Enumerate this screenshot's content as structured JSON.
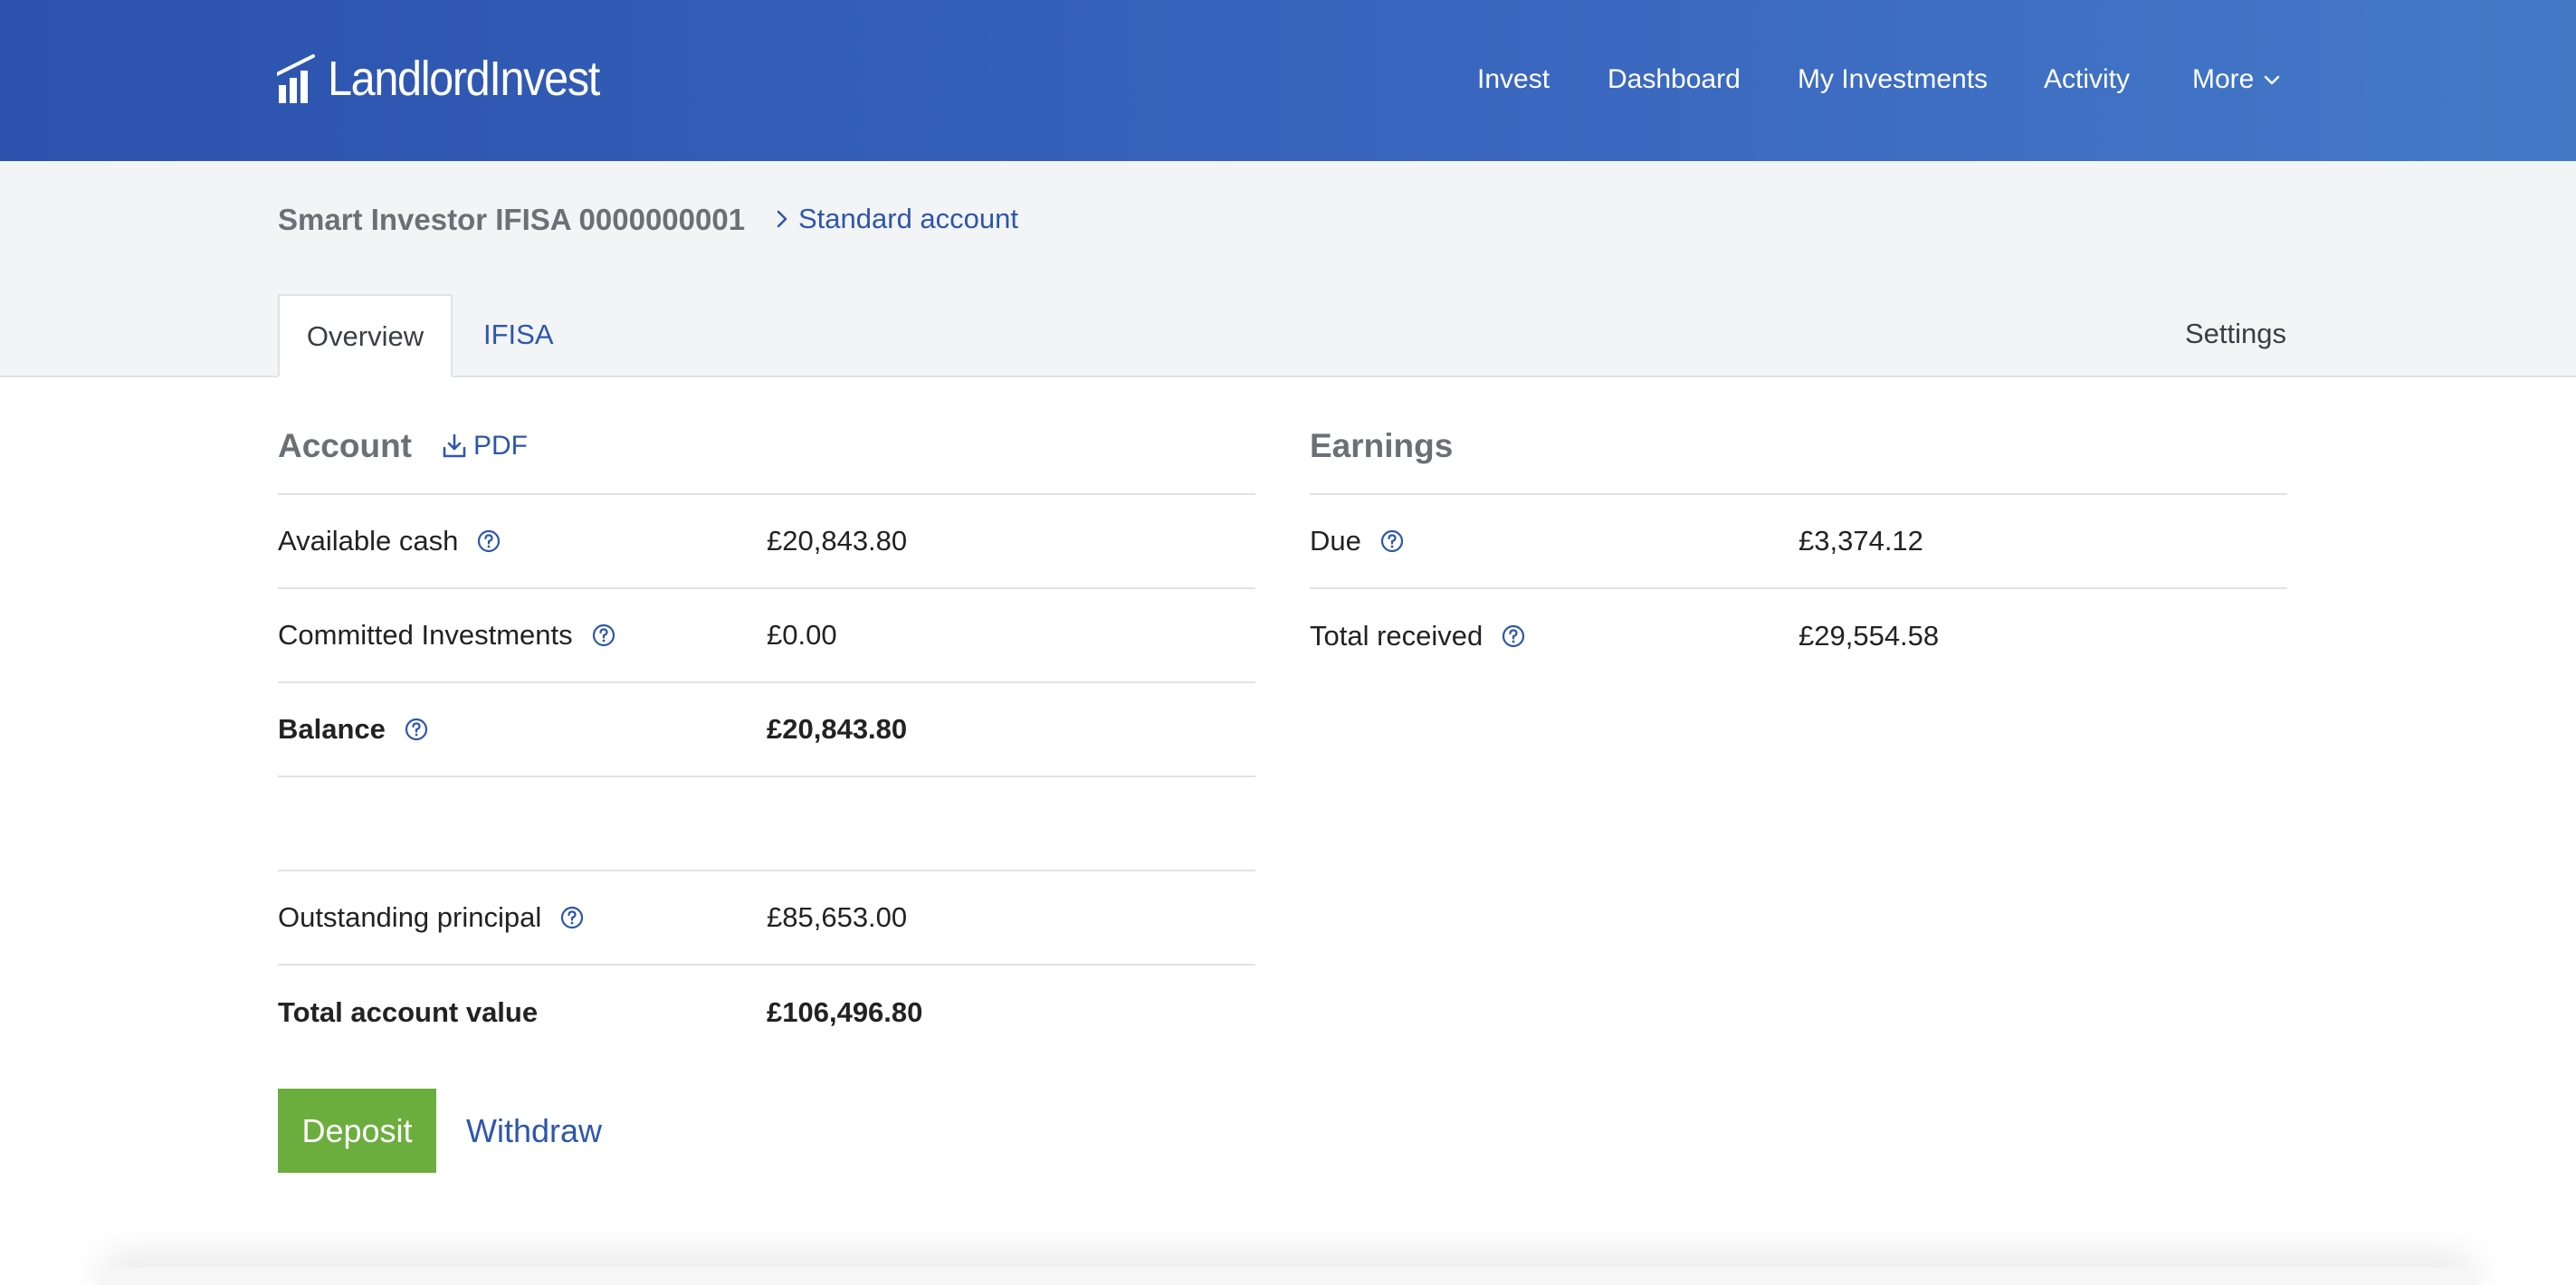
{
  "header": {
    "logo_text": "LandlordInvest",
    "nav": [
      {
        "label": "Invest"
      },
      {
        "label": "Dashboard"
      },
      {
        "label": "My Investments"
      },
      {
        "label": "Activity"
      },
      {
        "label": "More"
      }
    ]
  },
  "account_bar": {
    "title": "Smart Investor IFISA 0000000001",
    "switch_link": "Standard account"
  },
  "tabs": [
    {
      "label": "Overview",
      "active": true
    },
    {
      "label": "IFISA",
      "active": false
    }
  ],
  "settings_label": "Settings",
  "account": {
    "title": "Account",
    "pdf_label": "PDF",
    "rows": [
      {
        "label": "Available cash",
        "value": "£20,843.80"
      },
      {
        "label": "Committed Investments",
        "value": "£0.00"
      },
      {
        "label": "Balance",
        "value": "£20,843.80"
      },
      {
        "label": "Outstanding principal",
        "value": "£85,653.00"
      },
      {
        "label": "Total account value",
        "value": "£106,496.80"
      }
    ],
    "deposit_label": "Deposit",
    "withdraw_label": "Withdraw"
  },
  "earnings": {
    "title": "Earnings",
    "rows": [
      {
        "label": "Due",
        "value": "£3,374.12"
      },
      {
        "label": "Total received",
        "value": "£29,554.58"
      }
    ]
  },
  "colors": {
    "header_gradient_start": "#2b52ad",
    "header_gradient_end": "#4479c8",
    "link_blue": "#2d56ad",
    "deposit_green": "#6cae3e",
    "band_grey": "#f3f4f6"
  },
  "icons": {
    "logo": "bar-chart-logo-icon",
    "more": "chevron-down-icon",
    "standard_account": "chevron-right-icon",
    "pdf": "download-icon",
    "help": "question-circle-icon"
  }
}
